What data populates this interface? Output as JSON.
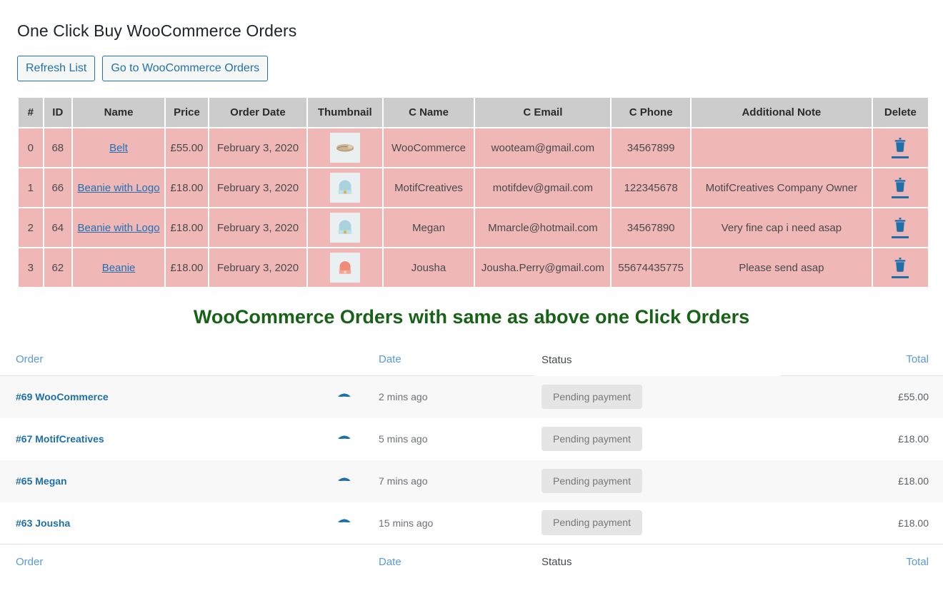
{
  "header": {
    "title": "One Click Buy WooCommerce Orders",
    "buttons": [
      {
        "label": "Refresh List",
        "name": "refresh-list-button"
      },
      {
        "label": "Go to WooCommerce Orders",
        "name": "go-to-woocommerce-orders-button"
      }
    ]
  },
  "one_click_table": {
    "columns": [
      "#",
      "ID",
      "Name",
      "Price",
      "Order Date",
      "Thumbnail",
      "C Name",
      "C Email",
      "C Phone",
      "Additional Note",
      "Delete"
    ],
    "rows": [
      {
        "index": "0",
        "id": "68",
        "name": "Belt",
        "price": "£55.00",
        "order_date": "February 3, 2020",
        "thumbnail": "belt-thumbnail",
        "c_name": "WooCommerce",
        "c_email": "wooteam@gmail.com",
        "c_phone": "34567899",
        "note": "",
        "delete": "trash-icon"
      },
      {
        "index": "1",
        "id": "66",
        "name": "Beanie with Logo",
        "price": "£18.00",
        "order_date": "February 3, 2020",
        "thumbnail": "blue-beanie-thumbnail",
        "c_name": "MotifCreatives",
        "c_email": "motifdev@gmail.com",
        "c_phone": "122345678",
        "note": "MotifCreatives Company Owner",
        "delete": "trash-icon"
      },
      {
        "index": "2",
        "id": "64",
        "name": "Beanie with Logo",
        "price": "£18.00",
        "order_date": "February 3, 2020",
        "thumbnail": "blue-beanie-thumbnail",
        "c_name": "Megan",
        "c_email": "Mmarcle@hotmail.com",
        "c_phone": "34567890",
        "note": "Very fine cap i need asap",
        "delete": "trash-icon"
      },
      {
        "index": "3",
        "id": "62",
        "name": "Beanie",
        "price": "£18.00",
        "order_date": "February 3, 2020",
        "thumbnail": "red-beanie-thumbnail",
        "c_name": "Jousha",
        "c_email": "Jousha.Perry@gmail.com",
        "c_phone": "55674435775",
        "note": "Please send asap",
        "delete": "trash-icon"
      }
    ]
  },
  "section_heading": "WooCommerce Orders with same as above one Click Orders",
  "woo_orders": {
    "columns": {
      "order": "Order",
      "date": "Date",
      "status": "Status",
      "total": "Total"
    },
    "rows": [
      {
        "order": "#69 WooCommerce",
        "preview": "eye-icon",
        "date": "2 mins ago",
        "status": "Pending payment",
        "total": "£55.00"
      },
      {
        "order": "#67 MotifCreatives",
        "preview": "eye-icon",
        "date": "5 mins ago",
        "status": "Pending payment",
        "total": "£18.00"
      },
      {
        "order": "#65 Megan",
        "preview": "eye-icon",
        "date": "7 mins ago",
        "status": "Pending payment",
        "total": "£18.00"
      },
      {
        "order": "#63 Jousha",
        "preview": "eye-icon",
        "date": "15 mins ago",
        "status": "Pending payment",
        "total": "£18.00"
      }
    ]
  },
  "colors": {
    "table_header_gray": "#cccccc",
    "table_cell_pink": "#f0b7b7",
    "link_blue": "#2271b1",
    "heading_green": "#186218",
    "badge_gray": "#e5e5e5",
    "header_link_blue": "#5a9ad4"
  }
}
